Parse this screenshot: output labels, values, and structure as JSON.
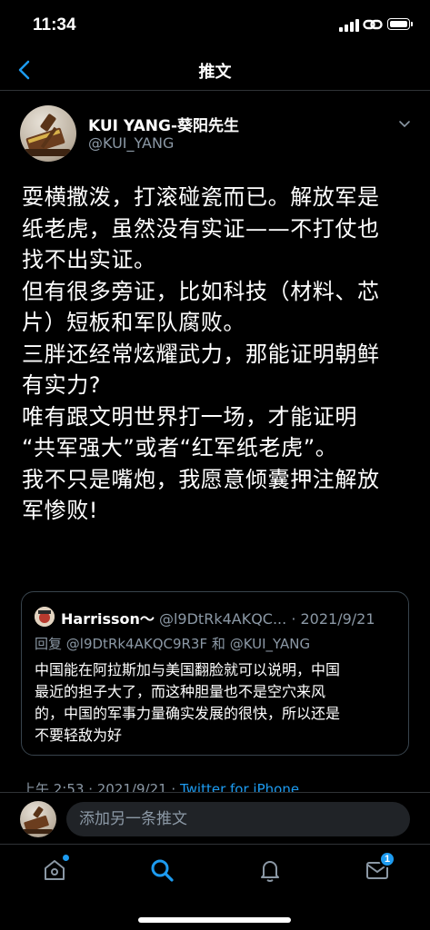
{
  "status_bar": {
    "time": "11:34"
  },
  "nav": {
    "title": "推文"
  },
  "author": {
    "name": "KUI YANG-葵阳先生",
    "handle": "@KUI_YANG"
  },
  "tweet": {
    "lines": [
      "耍横撒泼，打滚碰瓷而已。解放军是",
      "纸老虎，虽然没有实证——不打仗也",
      "找不出实证。",
      "但有很多旁证，比如科技（材料、芯",
      "片）短板和军队腐败。",
      "三胖还经常炫耀武力，那能证明朝鲜",
      "有实力?",
      "唯有跟文明世界打一场，才能证明",
      "“共军强大”或者“红军纸老虎”。",
      "我不只是嘴炮，我愿意倾囊押注解放",
      "军惨败!"
    ]
  },
  "quote": {
    "name": "Harrisson～",
    "handle": "@l9DtRk4AKQC...",
    "date": "· 2021/9/21",
    "reply_prefix": "回复",
    "reply_to_1": "@l9DtRk4AKQC9R3F",
    "reply_and": "和",
    "reply_to_2": "@KUI_YANG",
    "lines": [
      "中国能在阿拉斯加与美国翻脸就可以说明，中国",
      "最近的担子大了，而这种胆量也不是空穴来风",
      "的，中国的军事力量确实发展的很快，所以还是",
      "不要轻敌为好"
    ]
  },
  "meta": {
    "time": "上午 2:53 · 2021/9/21 · ",
    "via": "Twitter for iPhone"
  },
  "composer": {
    "placeholder": "添加另一条推文"
  },
  "tabbar": {
    "messages_badge": "1"
  },
  "colors": {
    "accent": "#1d9bf0",
    "background": "#000000",
    "secondary_text": "#8b98a5"
  }
}
